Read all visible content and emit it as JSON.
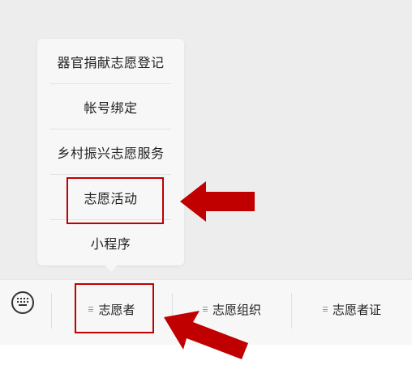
{
  "menu": {
    "items": [
      {
        "label": "器官捐献志愿登记"
      },
      {
        "label": "帐号绑定"
      },
      {
        "label": "乡村振兴志愿服务"
      },
      {
        "label": "志愿活动"
      },
      {
        "label": "小程序"
      }
    ]
  },
  "bottom_bar": {
    "keyboard_icon": "keyboard-icon",
    "tabs": [
      {
        "label": "志愿者",
        "icon": "menu-lines-icon"
      },
      {
        "label": "志愿组织",
        "icon": "menu-lines-icon"
      },
      {
        "label": "志愿者证",
        "icon": "menu-lines-icon"
      }
    ]
  },
  "annotations": {
    "highlight_color": "#c00000",
    "arrow_color": "#c00000"
  }
}
